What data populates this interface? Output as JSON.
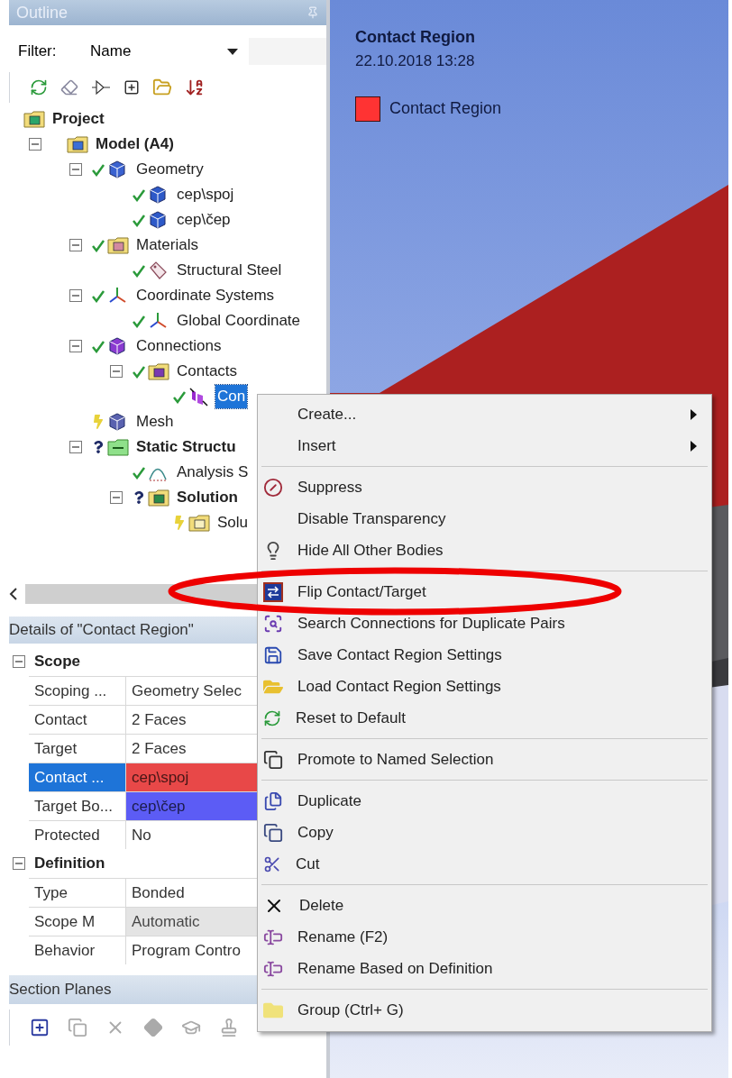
{
  "outline": {
    "title": "Outline",
    "filter_label": "Filter:",
    "filter_value": "Name"
  },
  "tree": [
    {
      "label": "Project",
      "kind": "project",
      "bold": true,
      "selected": false,
      "children": [
        {
          "label": "Model (A4)",
          "kind": "model",
          "bold": true,
          "selected": false,
          "expanded": true,
          "children": [
            {
              "label": "Geometry",
              "kind": "geometry",
              "status": {
                "kind": "ok"
              },
              "bold": false,
              "selected": false,
              "expanded": true,
              "children": [
                {
                  "label": "cep\\spoj",
                  "kind": "body",
                  "status": {
                    "kind": "ok"
                  },
                  "bold": false,
                  "selected": false
                },
                {
                  "label": "cep\\čep",
                  "kind": "body",
                  "status": {
                    "kind": "ok"
                  },
                  "bold": false,
                  "selected": false
                }
              ]
            },
            {
              "label": "Materials",
              "kind": "materials",
              "status": {
                "kind": "ok"
              },
              "bold": false,
              "selected": false,
              "expanded": true,
              "children": [
                {
                  "label": "Structural Steel",
                  "kind": "material",
                  "status": {
                    "kind": "ok"
                  },
                  "bold": false,
                  "selected": false
                }
              ]
            },
            {
              "label": "Coordinate Systems",
              "kind": "axes",
              "status": {
                "kind": "ok"
              },
              "bold": false,
              "selected": false,
              "expanded": true,
              "children": [
                {
                  "label": "Global Coordinate",
                  "kind": "axes",
                  "status": {
                    "kind": "ok"
                  },
                  "bold": false,
                  "selected": false
                }
              ]
            },
            {
              "label": "Connections",
              "kind": "connections",
              "status": {
                "kind": "ok"
              },
              "bold": false,
              "selected": false,
              "expanded": true,
              "children": [
                {
                  "label": "Contacts",
                  "kind": "contacts",
                  "status": {
                    "kind": "ok"
                  },
                  "bold": false,
                  "selected": false,
                  "expanded": true,
                  "children": [
                    {
                      "label": "Con",
                      "kind": "contact",
                      "status": {
                        "kind": "ok"
                      },
                      "bold": false,
                      "selected": true
                    }
                  ]
                }
              ]
            },
            {
              "label": "Mesh",
              "kind": "mesh",
              "status": {
                "kind": "pending"
              },
              "bold": false,
              "selected": false
            },
            {
              "label": "Static Structu",
              "kind": "analysis",
              "status": {
                "kind": "unknown"
              },
              "bold": true,
              "selected": false,
              "expanded": true,
              "children": [
                {
                  "label": "Analysis S",
                  "kind": "settings",
                  "status": {
                    "kind": "ok"
                  },
                  "bold": false,
                  "selected": false
                },
                {
                  "label": "Solution",
                  "kind": "solution",
                  "status": {
                    "kind": "unknown"
                  },
                  "bold": true,
                  "selected": false,
                  "expanded": true,
                  "children": [
                    {
                      "label": "Solu",
                      "kind": "info",
                      "status": {
                        "kind": "pending"
                      },
                      "bold": false,
                      "selected": false
                    }
                  ]
                }
              ]
            }
          ]
        }
      ]
    }
  ],
  "details": {
    "title": "Details of \"Contact Region\"",
    "groups": [
      {
        "label": "Scope",
        "expanded": true,
        "rows": [
          {
            "property": "Scoping ...",
            "value": "Geometry Selec",
            "selected": false
          },
          {
            "property": "Contact",
            "value": "2 Faces",
            "selected": false
          },
          {
            "property": "Target",
            "value": "2 Faces",
            "selected": false
          },
          {
            "property": "Contact ...",
            "value": "cep\\spoj",
            "selected": true,
            "color": "#e84848"
          },
          {
            "property": "Target Bo...",
            "value": "cep\\čep",
            "selected": false,
            "color": "#5c5cf5"
          },
          {
            "property": "Protected",
            "value": "No",
            "selected": false
          }
        ]
      },
      {
        "label": "Definition",
        "expanded": true,
        "rows": [
          {
            "property": "Type",
            "value": "Bonded",
            "selected": false
          },
          {
            "property": "Scope M",
            "value": "Automatic",
            "selected": false,
            "color": "#e4e4e4"
          },
          {
            "property": "Behavior",
            "value": "Program Contro",
            "selected": false
          }
        ]
      }
    ]
  },
  "section_planes": {
    "title": "Section Planes"
  },
  "viewport": {
    "title": "Contact Region",
    "timestamp": "22.10.2018 13:28",
    "legend": [
      {
        "label": "Contact Region",
        "color": "#ff3333"
      }
    ]
  },
  "menu": {
    "sections": [
      [
        {
          "label": "Create...",
          "kind": "plain",
          "submenu": true
        },
        {
          "label": "Insert",
          "kind": "plain",
          "submenu": true
        }
      ],
      [
        {
          "label": "Suppress",
          "kind": "suppress",
          "submenu": false
        },
        {
          "label": "Disable Transparency",
          "kind": "plain",
          "submenu": false
        },
        {
          "label": "Hide All Other Bodies",
          "kind": "bulb",
          "submenu": false
        }
      ],
      [
        {
          "label": "Flip Contact/Target",
          "kind": "flip",
          "submenu": false
        },
        {
          "label": "Search Connections for Duplicate Pairs",
          "kind": "search",
          "submenu": false
        },
        {
          "label": "Save Contact Region Settings",
          "kind": "save",
          "submenu": false
        },
        {
          "label": "Load Contact Region Settings",
          "kind": "load",
          "submenu": false
        },
        {
          "label": "Reset to Default",
          "kind": "reset",
          "submenu": false
        }
      ],
      [
        {
          "label": "Promote to Named Selection",
          "kind": "promote",
          "submenu": false
        }
      ],
      [
        {
          "label": "Duplicate",
          "kind": "duplicate",
          "submenu": false
        },
        {
          "label": "Copy",
          "kind": "copy",
          "submenu": false
        },
        {
          "label": "Cut",
          "kind": "cut",
          "submenu": false
        }
      ],
      [
        {
          "label": "Delete",
          "kind": "delete",
          "submenu": false
        },
        {
          "label": "Rename (F2)",
          "kind": "rename",
          "submenu": false
        },
        {
          "label": "Rename Based on Definition",
          "kind": "rename",
          "submenu": false
        }
      ],
      [
        {
          "label": "Group (Ctrl+ G)",
          "kind": "folder",
          "submenu": false
        }
      ]
    ]
  }
}
